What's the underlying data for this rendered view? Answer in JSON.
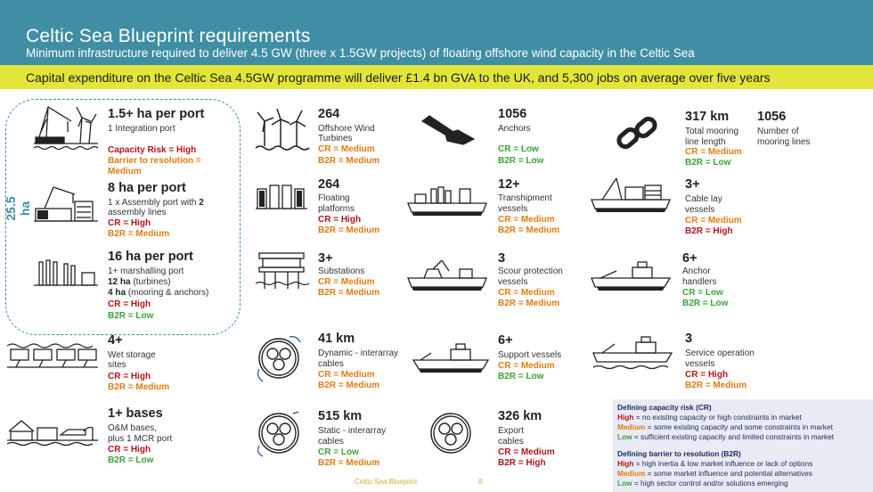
{
  "header": {
    "title": "Celtic Sea Blueprint requirements",
    "subtitle": "Minimum infrastructure required to deliver 4.5 GW (three x 1.5GW projects) of floating offshore wind capacity in the Celtic Sea",
    "banner": "Capital expenditure on the Celtic Sea 4.5GW programme will deliver £1.4 bn GVA to the UK,  and 5,300 jobs on average over five years"
  },
  "ports_total": "25.5 ha",
  "items": {
    "integration_port": {
      "icon": "crane-wind-icon",
      "big": "1.5+ ha per port",
      "desc": "1 Integration port",
      "r1": "Capacity Risk = High",
      "r2": "Barrier to resolution = Medium"
    },
    "assembly_port": {
      "icon": "assembly-crane-icon",
      "big": "8 ha per port",
      "desc_a": "1 x Assembly port with ",
      "desc_b": "2",
      "desc_c": " assembly lines",
      "r1": "CR = High",
      "r2": "B2R = Medium"
    },
    "marshalling_port": {
      "icon": "marshalling-icon",
      "big": "16 ha per port",
      "desc1": "1+ marshalling port",
      "desc2a": "12 ha",
      "desc2b": " (turbines)",
      "desc3a": "4 ha",
      "desc3b": " (mooring & anchors)",
      "r1": "CR = High",
      "r2": "B2R = Low"
    },
    "wet_storage": {
      "icon": "wet-storage-icon",
      "big": "4+",
      "desc1": "Wet storage",
      "desc2": "sites",
      "r1": "CR = High",
      "r2": "B2R = Medium"
    },
    "om_bases": {
      "icon": "om-base-icon",
      "big": "1+ bases",
      "desc1": "O&M bases,",
      "desc2": "plus 1 MCR port",
      "r1": "CR = High",
      "r2": "B2R = Low"
    },
    "turbines": {
      "icon": "wind-turbines-icon",
      "big": "264",
      "desc1": "Offshore Wind",
      "desc2": "Turbines",
      "r1": "CR = Medium",
      "r2": "B2R = Medium"
    },
    "platforms": {
      "icon": "floating-platform-icon",
      "big": "264",
      "desc1": "Floating",
      "desc2": "platforms",
      "r1": "CR = High",
      "r2": "B2R = Medium"
    },
    "substations": {
      "icon": "substation-icon",
      "big": "3+",
      "desc1": "Substations",
      "r1": "CR = Medium",
      "r2": "B2R = Medium"
    },
    "dynamic_cables": {
      "icon": "dynamic-cable-icon",
      "big": "41 km",
      "desc1": "Dynamic - interarray",
      "desc2": "cables",
      "r1": "CR = Medium",
      "r2": "B2R = Medium"
    },
    "static_cables": {
      "icon": "static-cable-icon",
      "big": "515 km",
      "desc1": "Static - interarray",
      "desc2": "cables",
      "r1": "CR = Low",
      "r2": "B2R = Medium"
    },
    "anchors": {
      "icon": "anchor-icon",
      "big": "1056",
      "desc1": "Anchors",
      "r1": "CR = Low",
      "r2": "B2R = Low"
    },
    "transhipment": {
      "icon": "transhipment-vessel-icon",
      "big": "12+",
      "desc1": "Transhipment",
      "desc2": "vessels",
      "r1": "CR = Medium",
      "r2": "B2R = Medium"
    },
    "scour": {
      "icon": "scour-vessel-icon",
      "big": "3",
      "desc1": "Scour protection",
      "desc2": "vessels",
      "r1": "CR = Medium",
      "r2": "B2R = Medium"
    },
    "support": {
      "icon": "support-vessel-icon",
      "big": "6+",
      "desc1": "Support vessels",
      "r1": "CR = Medium",
      "r2": "B2R = Low"
    },
    "export_cables": {
      "icon": "export-cable-icon",
      "big": "326 km",
      "desc1": "Export",
      "desc2": "cables",
      "r1": "CR = Medium",
      "r2": "B2R = High"
    },
    "mooring": {
      "icon": "chain-icon",
      "big": "317 km",
      "desc1": "Total mooring",
      "desc2": "line length",
      "r1": "CR = Medium",
      "r2": "B2R = Low",
      "big2": "1056",
      "desc3": "Number of",
      "desc4": "mooring lines"
    },
    "cable_lay": {
      "icon": "cable-lay-vessel-icon",
      "big": "3+",
      "desc1": "Cable lay",
      "desc2": "vessels",
      "r1": "CR = Medium",
      "r2": "B2R = High"
    },
    "anchor_handlers": {
      "icon": "anchor-handler-icon",
      "big": "6+",
      "desc1": "Anchor",
      "desc2": "handlers",
      "r1": "CR = Low",
      "r2": "B2R = Low"
    },
    "service_op": {
      "icon": "service-vessel-icon",
      "big": "3",
      "desc1": "Service operation",
      "desc2": "vessels",
      "r1": "CR = High",
      "r2": "B2R = Medium"
    }
  },
  "legend": {
    "cr_title": "Defining capacity risk (CR)",
    "cr_high_k": "High",
    "cr_high_v": " = no existing capacity or high constraints in market",
    "cr_med_k": "Medium",
    "cr_med_v": " = some existing capacity and some constraints in market",
    "cr_low_k": "Low",
    "cr_low_v": " = sufficient existing capacity and limited constraints in market",
    "b2r_title": "Defining barrier to resolution (B2R)",
    "b2r_high_k": "High",
    "b2r_high_v": " = high inertia & low market influence or lack of options",
    "b2r_med_k": "Medium",
    "b2r_med_v": " = some market influence and potential alternatives",
    "b2r_low_k": "Low",
    "b2r_low_v": " = high sector control and/or solutions emerging"
  },
  "footer": {
    "text": "Celtic Sea Blueprint",
    "page": "8"
  },
  "colors": {
    "header": "#3f8ea4",
    "banner": "#e3e63a",
    "high": "#b0141c",
    "medium": "#e07b12",
    "low": "#3aa335"
  }
}
